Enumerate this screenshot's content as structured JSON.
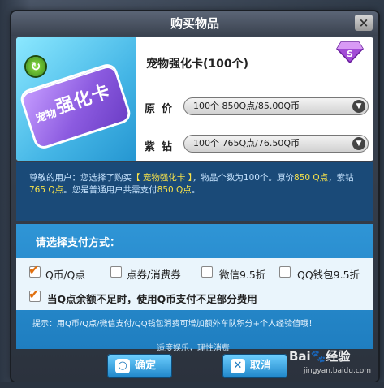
{
  "dialog": {
    "title": "购买物品",
    "close_label": "×"
  },
  "product": {
    "name": "宠物强化卡(100个)",
    "card_pet": "宠物",
    "card_name": "强化卡",
    "price_label": "原价",
    "price_value": "100个  850Q点/85.00Q币",
    "purple_label": "紫钻",
    "purple_value": "100个  765Q点/76.50Q币"
  },
  "notice": {
    "p1": "尊敬的用户：您选择了购买",
    "item": "【 宠物强化卡 】",
    "p2": "，物品个数为100个。原价",
    "orig": "850 Q点",
    "p3": "，紫钻",
    "purple": "765 Q点",
    "p4": "。您是普通用户共需支付",
    "total": "850 Q点",
    "p5": "。"
  },
  "payment": {
    "title": "请选择支付方式：",
    "options": [
      {
        "label": "Q币/Q点",
        "checked": true
      },
      {
        "label": "点券/消费券",
        "checked": false
      },
      {
        "label": "微信9.5折",
        "checked": false
      },
      {
        "label": "QQ钱包9.5折",
        "checked": false
      }
    ],
    "fallback_label": "当Q点余额不足时，使用Q币支付不足部分费用",
    "fallback_checked": true,
    "hint": "提示：用Q币/Q点/微信支付/QQ钱包消费可增加额外车队积分+个人经验值哦！",
    "motto": "适度娱乐，理性消费"
  },
  "buttons": {
    "confirm": "确定",
    "cancel": "取消"
  },
  "watermark": {
    "brand": "Bai",
    "brand_suffix": "经验",
    "url": "jingyan.baidu.com"
  },
  "colors": {
    "accent_blue": "#1f7ec0",
    "checkmark": "#e07010",
    "highlight": "#f7e24a"
  }
}
